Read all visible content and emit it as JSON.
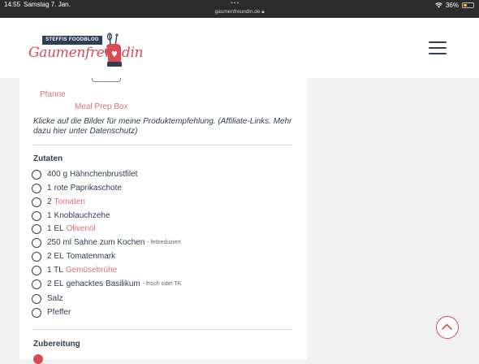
{
  "status_bar": {
    "time": "14:55",
    "date": "Samstag 7. Jan.",
    "url": "gaumenfreundin.de",
    "battery": "36%"
  },
  "logo": {
    "banner": "STEFFIS FOODBLOG",
    "name": "Gaumenfreundin"
  },
  "equipment": {
    "item1": "Pfanne",
    "item2": "Meal Prep Box"
  },
  "affiliate_note": "Klicke auf die Bilder für meine Produktempfehlung. (Affiliate-Links. Mehr dazu hier unter Datenschutz)",
  "ingredients_title": "Zutaten",
  "ingredients": [
    {
      "amount": "400 g",
      "name": "Hähnchenbrustfilet",
      "note": ""
    },
    {
      "amount": "1",
      "name": "rote Paprikaschote",
      "note": ""
    },
    {
      "amount": "2",
      "name": "Tomaten",
      "note": ""
    },
    {
      "amount": "1",
      "name": "Knoblauchzehe",
      "note": ""
    },
    {
      "amount": "1 EL",
      "name": "Olivenöl",
      "note": ""
    },
    {
      "amount": "250 ml",
      "name": "Sahne zum Kochen",
      "note": "- fettreduziert"
    },
    {
      "amount": "2 EL",
      "name": "Tomatenmark",
      "note": ""
    },
    {
      "amount": "1 TL",
      "name": "Gemüsebrühe",
      "note": ""
    },
    {
      "amount": "2 EL",
      "name": "gehacktes Basilikum",
      "note": "- frisch oder TK"
    },
    {
      "amount": "",
      "name": "Salz",
      "note": ""
    },
    {
      "amount": "",
      "name": "Pfeffer",
      "note": ""
    }
  ],
  "preparation_title": "Zubereitung",
  "colors": {
    "accent": "#d94a57",
    "link": "#d9707a",
    "navy": "#2f3e56"
  }
}
